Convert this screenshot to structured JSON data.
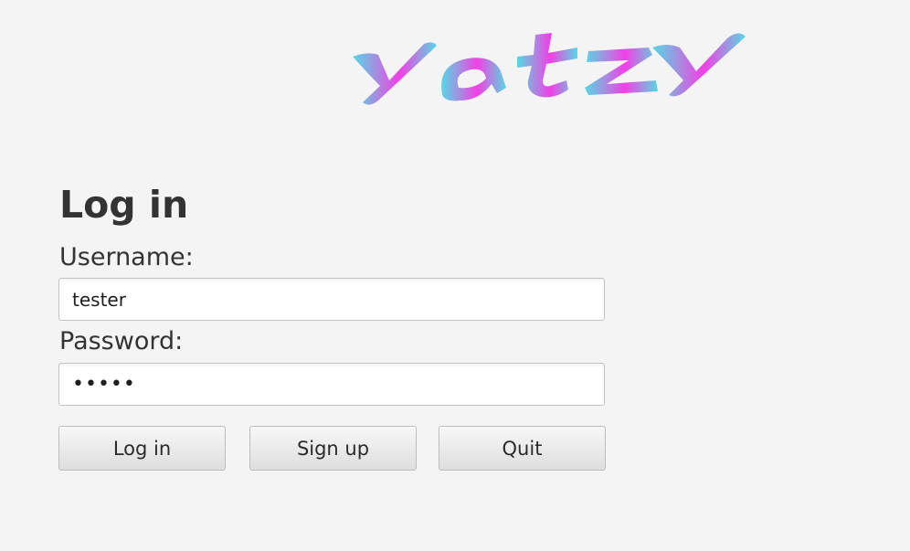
{
  "logo": {
    "text": "Yatzy",
    "colors": [
      "#54d8e6",
      "#a58ee0",
      "#f13fe6",
      "#a58ee0",
      "#54d8e6"
    ]
  },
  "form": {
    "title": "Log in",
    "username_label": "Username:",
    "username_value": "tester",
    "password_label": "Password:",
    "password_value": "•••••"
  },
  "buttons": {
    "login": "Log in",
    "signup": "Sign up",
    "quit": "Quit"
  }
}
